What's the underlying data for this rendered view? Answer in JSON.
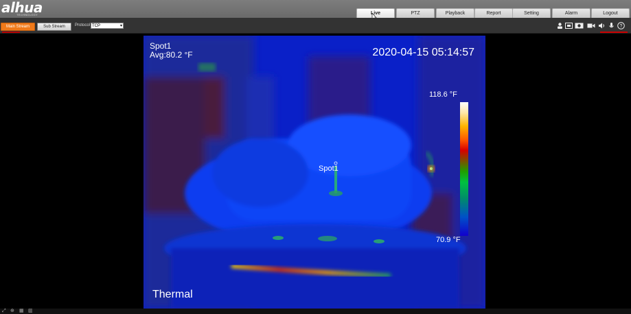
{
  "brand": {
    "logo": "alhua",
    "logo_sub": "TECHNOLOGY"
  },
  "nav": {
    "tabs": [
      {
        "label": "Live",
        "active": true
      },
      {
        "label": "PTZ",
        "active": false
      },
      {
        "label": "Playback",
        "active": false
      },
      {
        "label": "Report",
        "active": false
      },
      {
        "label": "Setting",
        "active": false
      },
      {
        "label": "Alarm",
        "active": false
      },
      {
        "label": "Logout",
        "active": false
      }
    ]
  },
  "toolbar": {
    "main_stream": "Main Stream",
    "sub_stream": "Sub Stream",
    "protocol_label": "Protocol",
    "protocol_value": "TCP",
    "icons": [
      "person-icon",
      "capture-icon",
      "snapshot-icon",
      "record-icon",
      "audio-icon",
      "mic-icon",
      "help-icon"
    ]
  },
  "video": {
    "spot_name": "Spot1",
    "spot_avg": "Avg:80.2 °F",
    "timestamp": "2020-04-15 05:14:57",
    "temp_max": "118.6 °F",
    "temp_min": "70.9 °F",
    "spot_label": "Spot1",
    "channel": "Thermal"
  },
  "colors": {
    "accent": "#f07a1a",
    "video_bg": "#0a24d8"
  }
}
